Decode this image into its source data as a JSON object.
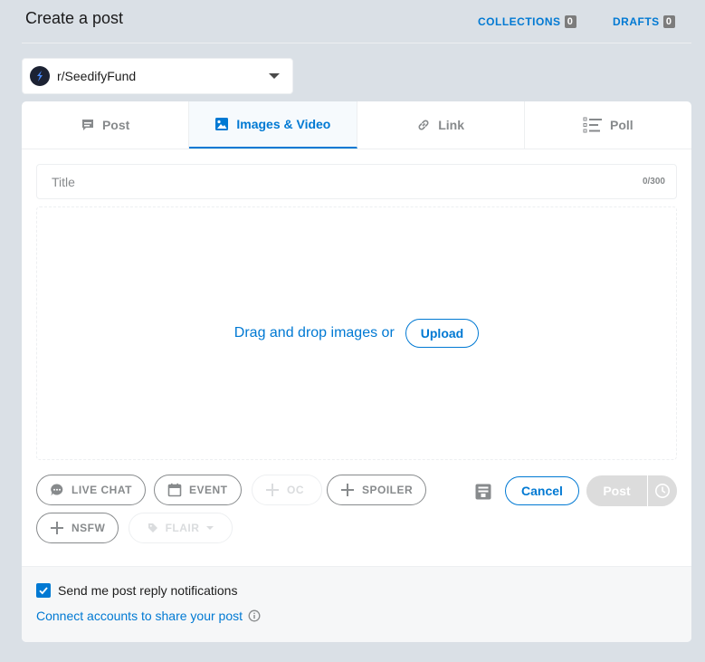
{
  "header": {
    "title": "Create a post",
    "collections_label": "COLLECTIONS",
    "collections_count": "0",
    "drafts_label": "DRAFTS",
    "drafts_count": "0"
  },
  "community": {
    "name": "r/SeedifyFund"
  },
  "tabs": [
    {
      "label": "Post",
      "icon": "post-icon"
    },
    {
      "label": "Images & Video",
      "icon": "image-icon",
      "active": true
    },
    {
      "label": "Link",
      "icon": "link-icon"
    },
    {
      "label": "Poll",
      "icon": "poll-icon"
    }
  ],
  "title_field": {
    "placeholder": "Title",
    "counter": "0/300"
  },
  "dropzone": {
    "text": "Drag and drop images or",
    "upload_label": "Upload"
  },
  "tags": {
    "live_chat": "LIVE CHAT",
    "event": "EVENT",
    "oc": "OC",
    "spoiler": "SPOILER",
    "nsfw": "NSFW",
    "flair": "FLAIR"
  },
  "actions": {
    "cancel": "Cancel",
    "post": "Post"
  },
  "footer": {
    "notifications_label": "Send me post reply notifications",
    "notifications_checked": true,
    "connect_label": "Connect accounts to share your post"
  },
  "colors": {
    "accent": "#0079d3",
    "background": "#dae0e6",
    "muted": "#878a8c"
  }
}
